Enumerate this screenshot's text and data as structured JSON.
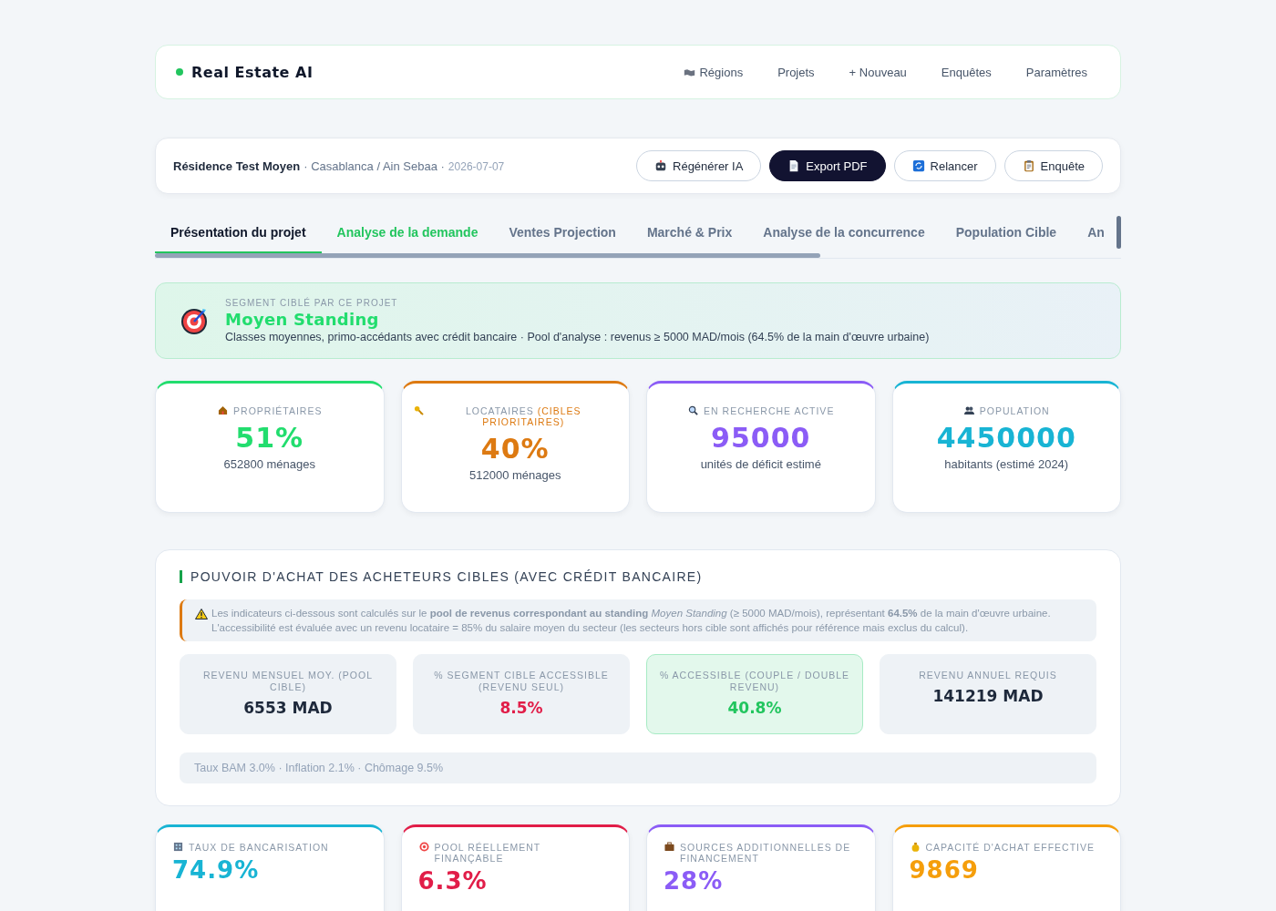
{
  "nav": {
    "brand": "Real Estate AI",
    "links": [
      {
        "label": "Régions"
      },
      {
        "label": "Projets"
      },
      {
        "label": "+ Nouveau"
      },
      {
        "label": "Enquêtes"
      },
      {
        "label": "Paramètres"
      }
    ]
  },
  "project": {
    "name": "Résidence Test Moyen",
    "location": "· Casablanca / Ain Sebaa ·",
    "date": "2026-07-07",
    "actions": [
      {
        "label": "Régénérer IA",
        "kind": "light"
      },
      {
        "label": "Export PDF",
        "kind": "dark"
      },
      {
        "label": "Relancer",
        "kind": "light"
      },
      {
        "label": "Enquête",
        "kind": "light"
      }
    ]
  },
  "tabs": [
    {
      "label": "Présentation du projet",
      "selected": true,
      "highlighted": false
    },
    {
      "label": "Analyse de la demande",
      "selected": false,
      "highlighted": true
    },
    {
      "label": "Ventes Projection",
      "selected": false,
      "highlighted": false
    },
    {
      "label": "Marché & Prix",
      "selected": false,
      "highlighted": false
    },
    {
      "label": "Analyse de la concurrence",
      "selected": false,
      "highlighted": false
    },
    {
      "label": "Population Cible",
      "selected": false,
      "highlighted": false
    },
    {
      "label": "An",
      "selected": false,
      "highlighted": false
    }
  ],
  "segment": {
    "eyebrow": "SEGMENT CIBLÉ PAR CE PROJET",
    "title": "Moyen Standing",
    "description": "Classes moyennes, primo-accédants avec crédit bancaire · Pool d'analyse : revenus ≥ 5000 MAD/mois (64.5% de la main d'œuvre urbaine)"
  },
  "stats": [
    {
      "label": "PROPRIÉTAIRES",
      "value": "51%",
      "caption": "652800 ménages",
      "color": "#22dd6e"
    },
    {
      "label": "LOCATAIRES",
      "label_accent": "(CIBLES PRIORITAIRES)",
      "value": "40%",
      "caption": "512000 ménages",
      "color": "#dd7a12"
    },
    {
      "label": "EN RECHERCHE ACTIVE",
      "value": "95000",
      "caption": "unités de déficit estimé",
      "color": "#8b5cf6"
    },
    {
      "label": "POPULATION",
      "value": "4450000",
      "caption": "habitants (estimé 2024)",
      "color": "#18b4d4"
    }
  ],
  "purchasing": {
    "title": "POUVOIR D'ACHAT DES ACHETEURS CIBLES (AVEC CRÉDIT BANCAIRE)",
    "notice": "Les indicateurs ci-dessous sont calculés sur le **pool de revenus correspondant au standing** *Moyen Standing* (≥ 5000 MAD/mois), représentant **64.5%** de la main d'œuvre urbaine. L'accessibilité est évaluée avec un revenu locataire = 85% du salaire moyen du secteur (les secteurs hors cible sont affichés pour référence mais exclus du calcul).",
    "metrics": [
      {
        "label": "REVENU MENSUEL MOY. (POOL CIBLE)",
        "value": "6553 MAD",
        "color": "#1e293b",
        "highlighted": false
      },
      {
        "label": "% SEGMENT CIBLE ACCESSIBLE (REVENU SEUL)",
        "value": "8.5%",
        "color": "#e11d48",
        "highlighted": false
      },
      {
        "label": "% ACCESSIBLE (COUPLE / DOUBLE REVENU)",
        "value": "40.8%",
        "color": "#22c55e",
        "highlighted": true
      },
      {
        "label": "REVENU ANNUEL REQUIS",
        "value": "141219 MAD",
        "color": "#1e293b",
        "highlighted": false
      }
    ],
    "footer": "Taux BAM 3.0% · Inflation 2.1% · Chômage 9.5%"
  },
  "bottom_stats": [
    {
      "label": "TAUX DE BANCARISATION",
      "value": "74.9%",
      "color": "#18b4d4"
    },
    {
      "label": "POOL RÉELLEMENT FINANÇABLE",
      "value": "6.3%",
      "color": "#e11d48"
    },
    {
      "label": "SOURCES ADDITIONNELLES DE FINANCEMENT",
      "value": "28%",
      "color": "#8b5cf6"
    },
    {
      "label": "CAPACITÉ D'ACHAT EFFECTIVE",
      "value": "9869",
      "color": "#f59e0b"
    }
  ]
}
